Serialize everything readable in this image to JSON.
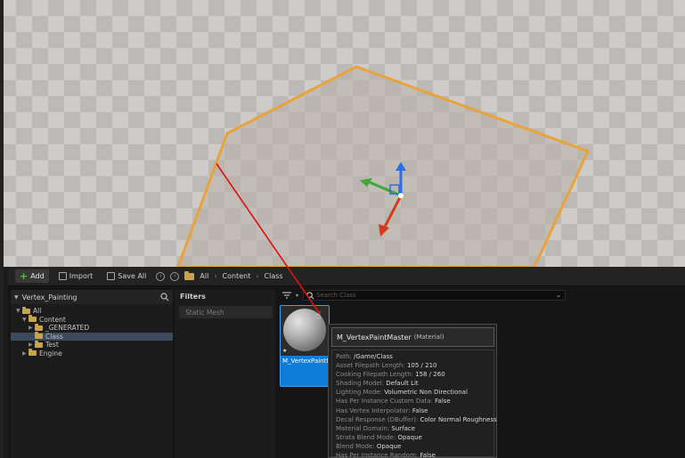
{
  "toolbar": {
    "add_label": "Add",
    "import_label": "Import",
    "save_all_label": "Save All",
    "breadcrumb": [
      "All",
      "Content",
      "Class"
    ]
  },
  "sources": {
    "title": "Vertex_Painting",
    "tree": [
      {
        "label": "All",
        "arrow": "▼",
        "indent": 0
      },
      {
        "label": "Content",
        "arrow": "▼",
        "indent": 1
      },
      {
        "label": "_GENERATED",
        "arrow": "▶",
        "indent": 2
      },
      {
        "label": "Class",
        "arrow": "",
        "indent": 2,
        "selected": true
      },
      {
        "label": "Test",
        "arrow": "▶",
        "indent": 2
      },
      {
        "label": "Engine",
        "arrow": "▶",
        "indent": 1
      }
    ]
  },
  "filters": {
    "title": "Filters",
    "items": [
      "Static Mesh"
    ]
  },
  "assets": {
    "search_placeholder": "Search Class",
    "tile_name": "M_VertexPaintMaster"
  },
  "tooltip": {
    "title": "M_VertexPaintMaster",
    "type": "(Material)",
    "rows": [
      {
        "key": "Path: ",
        "val": "/Game/Class"
      },
      {
        "key": "Asset Filepath Length: ",
        "val": "105 / 210"
      },
      {
        "key": "Cooking Filepath Length: ",
        "val": "158 / 260"
      },
      {
        "key": "Shading Model: ",
        "val": "Default Lit"
      },
      {
        "key": "Lighting Mode: ",
        "val": "Volumetric Non Directional"
      },
      {
        "key": "Has Per Instance Custom Data: ",
        "val": "False"
      },
      {
        "key": "Has Vertex Interpolator: ",
        "val": "False"
      },
      {
        "key": "Decal Response (DBuffer): ",
        "val": "Color Normal Roughness"
      },
      {
        "key": "Material Domain: ",
        "val": "Surface"
      },
      {
        "key": "Strata Blend Mode: ",
        "val": "Opaque"
      },
      {
        "key": "Blend Mode: ",
        "val": "Opaque"
      },
      {
        "key": "Has Per Instance Random: ",
        "val": "False"
      }
    ]
  },
  "colors": {
    "selection_blue": "#0e7cd9",
    "plane_outline": "#e8a33a",
    "annotation_line": "#e01010"
  }
}
